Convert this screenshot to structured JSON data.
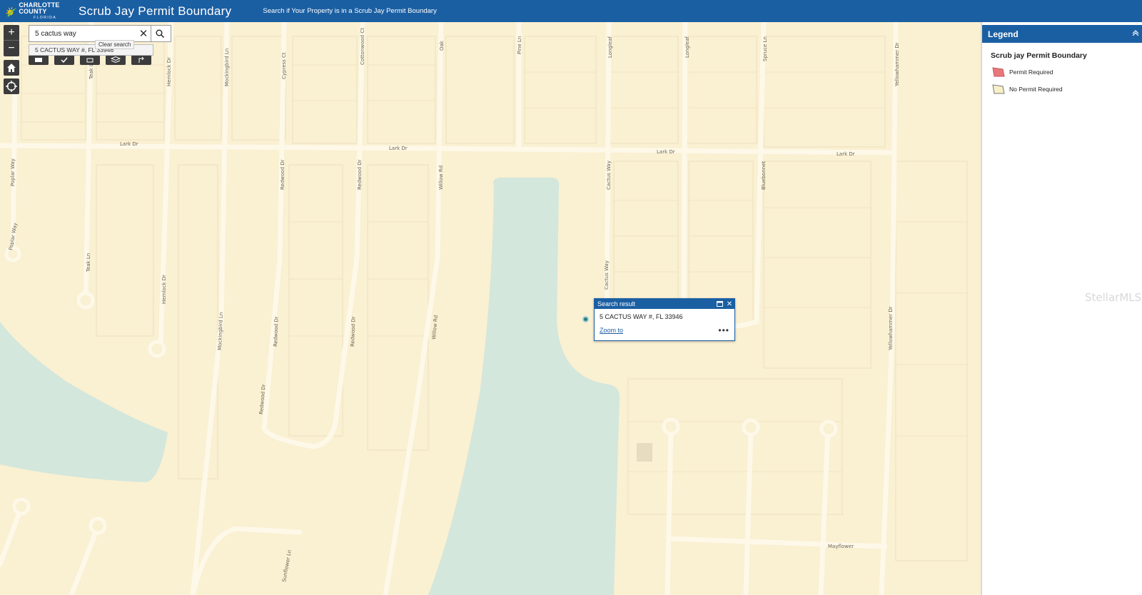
{
  "header": {
    "logo_line1": "CHARLOTTE COUNTY",
    "logo_line2": "FLORIDA",
    "title": "Scrub Jay Permit Boundary",
    "subtitle": "Search if Your Property is in a Scrub Jay Permit Boundary"
  },
  "search": {
    "value": "5 cactus way",
    "suggestion": "5 CACTUS WAY #, FL 33946",
    "clear_tooltip": "Clear search"
  },
  "controls": {
    "zoom_in": "+",
    "zoom_out": "−"
  },
  "popup": {
    "title": "Search result",
    "address": "5 CACTUS WAY #, FL 33946",
    "zoom_link": "Zoom to",
    "more": "•••"
  },
  "legend": {
    "header": "Legend",
    "layer_title": "Scrub jay Permit Boundary",
    "items": [
      {
        "label": "Permit Required",
        "color": "#e8787a"
      },
      {
        "label": "No Permit Required",
        "color": "#f7f0c8"
      }
    ]
  },
  "map": {
    "colors": {
      "land": "#faf0d2",
      "road": "#fdf8e8",
      "water": "#d3e7dc",
      "parcel": "#ece0bd"
    },
    "road_labels": {
      "lark1": "Lark Dr",
      "lark2": "Lark Dr",
      "lark3": "Lark Dr",
      "lark4": "Lark Dr",
      "poplar1": "Poplar Way",
      "poplar2": "Poplar Way",
      "teak1": "Teak Ln",
      "teak2": "Teak Ln",
      "hemlock1": "Hemlock Dr",
      "hemlock2": "Hemlock Dr",
      "mockingbird1": "Mockingbird Ln",
      "mockingbird2": "Mockingbird Ln",
      "cypress": "Cypress Ct",
      "redwood1": "Redwood Dr",
      "redwood2": "Redwood Dr",
      "redwood3": "Redwood Dr",
      "redwood4": "Redwood Dr",
      "redwood5": "Redwood Dr",
      "cottonwood": "Cottonwood Ct",
      "oak": "Oak",
      "willow1": "Willow Rd",
      "willow2": "Willow Rd",
      "pine": "Pine Ln",
      "longleaf1": "Longleaf",
      "longleaf2": "Longleaf",
      "cactus1": "Cactus Way",
      "cactus2": "Cactus Way",
      "spruce": "Spruce Ln",
      "bluebonnet": "Bluebonnet",
      "yellowhammer1": "Yellowhammer Dr",
      "yellowhammer2": "Yellowhammer Dr",
      "mayflower": "Mayflower",
      "sunflower": "Sunflower Ln"
    }
  },
  "watermark": "StellarMLS"
}
